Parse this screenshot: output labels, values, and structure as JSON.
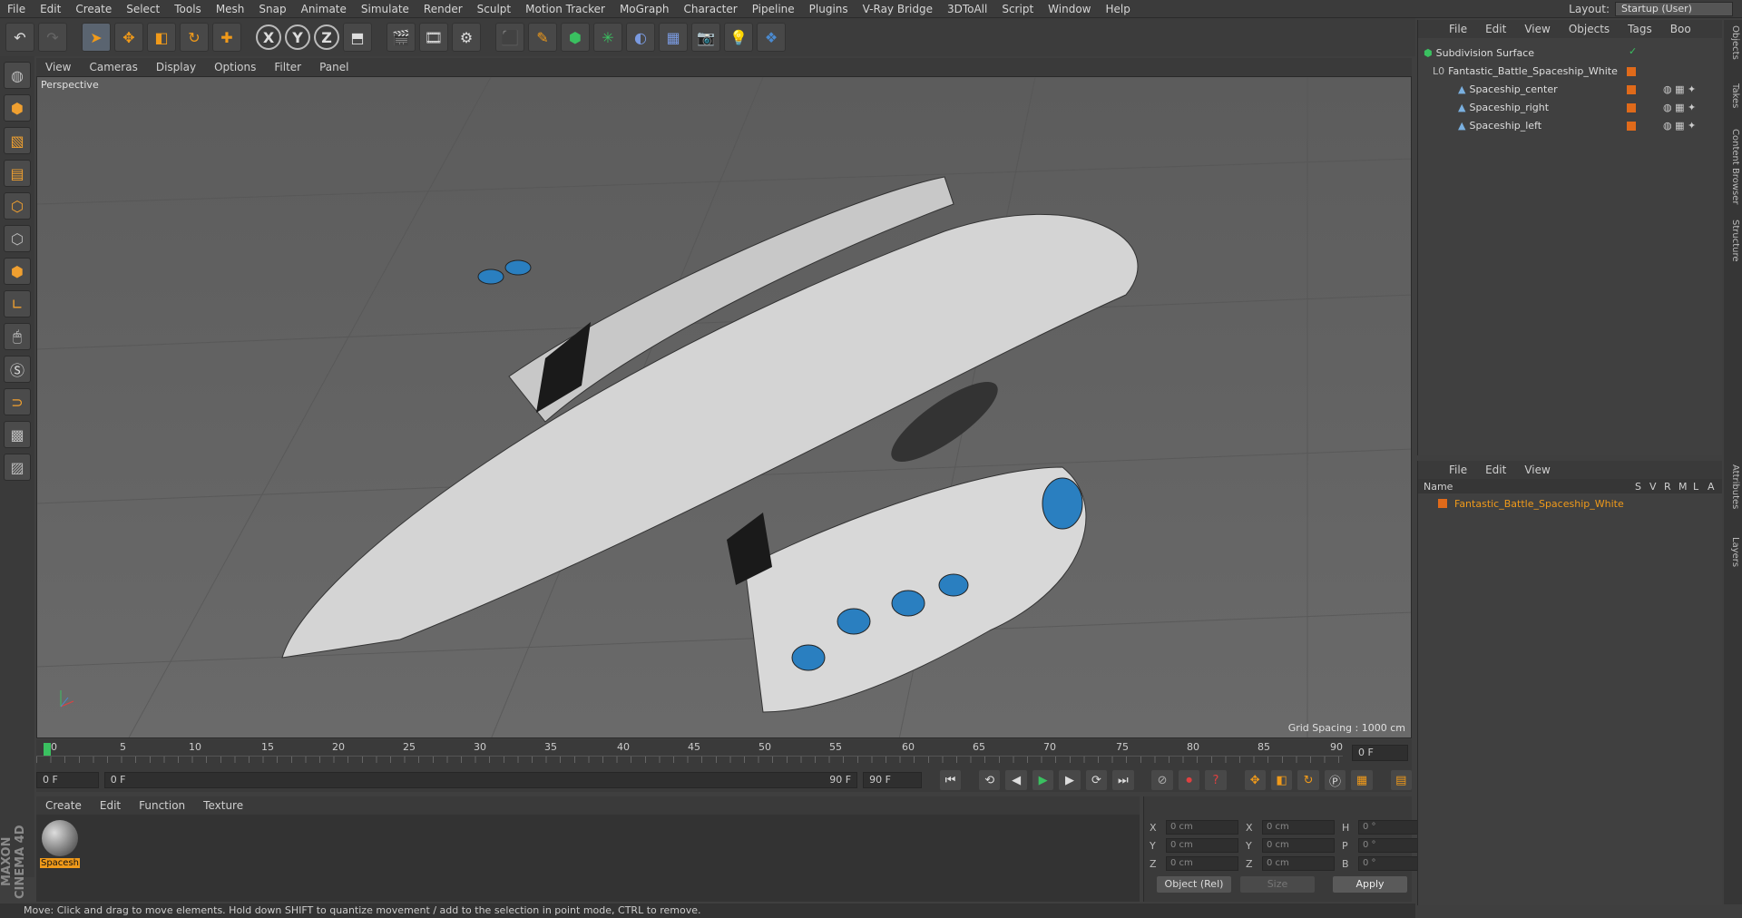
{
  "menubar": [
    "File",
    "Edit",
    "Create",
    "Select",
    "Tools",
    "Mesh",
    "Snap",
    "Animate",
    "Simulate",
    "Render",
    "Sculpt",
    "Motion Tracker",
    "MoGraph",
    "Character",
    "Pipeline",
    "Plugins",
    "V-Ray Bridge",
    "3DToAll",
    "Script",
    "Window",
    "Help"
  ],
  "layout": {
    "label": "Layout:",
    "value": "Startup (User)"
  },
  "viewport": {
    "menu": [
      "View",
      "Cameras",
      "Display",
      "Options",
      "Filter",
      "Panel"
    ],
    "label": "Perspective",
    "grid_spacing": "Grid Spacing : 1000 cm"
  },
  "timeline": {
    "ticks": [
      "0",
      "5",
      "10",
      "15",
      "20",
      "25",
      "30",
      "35",
      "40",
      "45",
      "50",
      "55",
      "60",
      "65",
      "70",
      "75",
      "80",
      "85",
      "90"
    ],
    "end_frame": "0 F"
  },
  "playbar": {
    "start": "0 F",
    "range_start": "0 F",
    "range_end": "90 F",
    "end": "90 F"
  },
  "material_manager": {
    "menu": [
      "Create",
      "Edit",
      "Function",
      "Texture"
    ],
    "material_label": "Spacesh"
  },
  "coordinates": {
    "rows": [
      {
        "a": "X",
        "av": "0 cm",
        "b": "X",
        "bv": "0 cm",
        "c": "H",
        "cv": "0 °"
      },
      {
        "a": "Y",
        "av": "0 cm",
        "b": "Y",
        "bv": "0 cm",
        "c": "P",
        "cv": "0 °"
      },
      {
        "a": "Z",
        "av": "0 cm",
        "b": "Z",
        "bv": "0 cm",
        "c": "B",
        "cv": "0 °"
      }
    ],
    "mode": "Object (Rel)",
    "size": "Size",
    "apply": "Apply"
  },
  "object_manager": {
    "menu": [
      "File",
      "Edit",
      "View",
      "Objects",
      "Tags",
      "Boo"
    ],
    "objects": [
      {
        "name": "Subdivision Surface"
      },
      {
        "name": "Fantastic_Battle_Spaceship_White"
      },
      {
        "name": "Spaceship_center"
      },
      {
        "name": "Spaceship_right"
      },
      {
        "name": "Spaceship_left"
      }
    ]
  },
  "layer_manager": {
    "menu": [
      "File",
      "Edit",
      "View"
    ],
    "header": "Name",
    "cols": [
      "S",
      "V",
      "R",
      "M",
      "L",
      "A"
    ],
    "layer": "Fantastic_Battle_Spaceship_White"
  },
  "side_tabs": [
    "Objects",
    "Takes",
    "Content Browser",
    "Structure",
    "Attributes",
    "Layers"
  ],
  "status": "Move: Click and drag to move elements. Hold down SHIFT to quantize movement / add to the selection in point mode, CTRL to remove.",
  "brand": "MAXON CINEMA 4D",
  "colors": {
    "accent": "#f09a1a",
    "tag": "#e06a1a",
    "blue": "#3a8fd0"
  }
}
